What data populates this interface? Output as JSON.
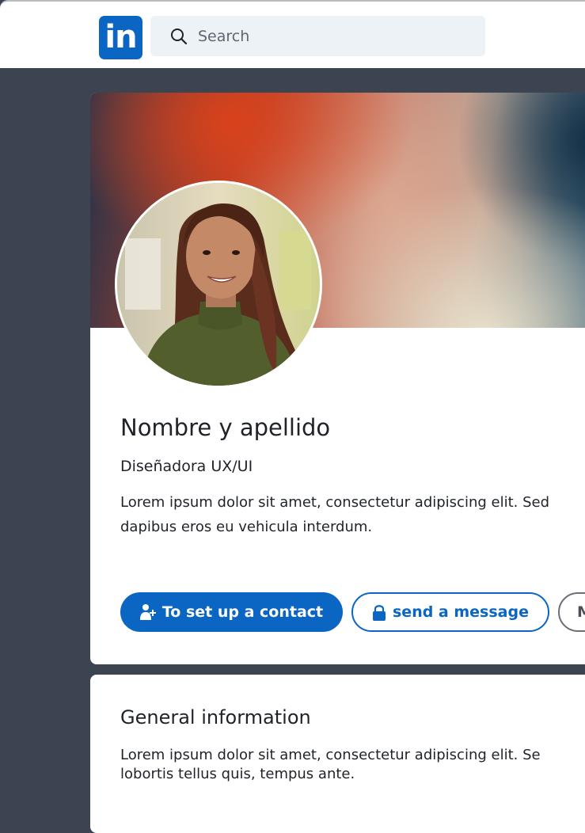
{
  "header": {
    "logo_text": "in",
    "search": {
      "placeholder": "Search",
      "value": ""
    }
  },
  "profile": {
    "name": "Nombre y apellido",
    "headline": "Diseñadora UX/UI",
    "bio": "Lorem ipsum dolor sit amet, consectetur adipiscing elit. Sed\ndapibus eros eu vehicula interdum.",
    "actions": {
      "connect_label": "To set up a contact",
      "message_label": "send a message",
      "more_label": "M"
    }
  },
  "general_info": {
    "title": "General information",
    "text": "Lorem ipsum dolor sit amet, consectetur adipiscing elit. Se\nlobortis tellus quis, tempus ante."
  },
  "colors": {
    "brand": "#0a66c2",
    "backdrop": "#3d4451",
    "search_bg": "#edf2f7"
  },
  "icons": {
    "logo": "linkedin-logo",
    "search": "search-icon",
    "connect": "add-person-icon",
    "message": "lock-icon"
  }
}
